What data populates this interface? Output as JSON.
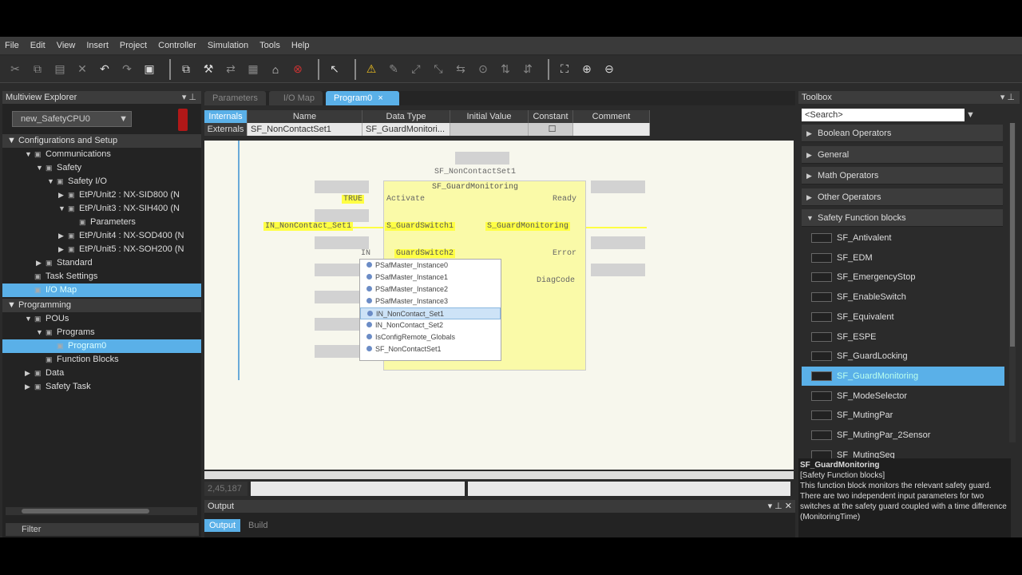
{
  "menu": [
    "File",
    "Edit",
    "View",
    "Insert",
    "Project",
    "Controller",
    "Simulation",
    "Tools",
    "Help"
  ],
  "explorer": {
    "title": "Multiview Explorer",
    "device": "new_SafetyCPU0",
    "config_section": "Configurations and Setup",
    "tree": [
      {
        "label": "Communications",
        "indent": 2,
        "twisty": "▼"
      },
      {
        "label": "Safety",
        "indent": 3,
        "twisty": "▼"
      },
      {
        "label": "Safety I/O",
        "indent": 4,
        "twisty": "▼"
      },
      {
        "label": "EtP/Unit2 : NX-SID800 (N",
        "indent": 5,
        "twisty": "▶"
      },
      {
        "label": "EtP/Unit3 : NX-SIH400 (N",
        "indent": 5,
        "twisty": "▼"
      },
      {
        "label": "Parameters",
        "indent": 6,
        "twisty": ""
      },
      {
        "label": "EtP/Unit4 : NX-SOD400 (N",
        "indent": 5,
        "twisty": "▶"
      },
      {
        "label": "EtP/Unit5 : NX-SOH200 (N",
        "indent": 5,
        "twisty": "▶"
      },
      {
        "label": "Standard",
        "indent": 3,
        "twisty": "▶"
      },
      {
        "label": "Task Settings",
        "indent": 2,
        "twisty": ""
      },
      {
        "label": "I/O Map",
        "indent": 2,
        "twisty": "",
        "selected": true
      }
    ],
    "programming_section": "Programming",
    "tree2": [
      {
        "label": "POUs",
        "indent": 2,
        "twisty": "▼"
      },
      {
        "label": "Programs",
        "indent": 3,
        "twisty": "▼"
      },
      {
        "label": "Program0",
        "indent": 4,
        "twisty": "",
        "selected": true
      },
      {
        "label": "Function Blocks",
        "indent": 3,
        "twisty": ""
      },
      {
        "label": "Data",
        "indent": 2,
        "twisty": "▶"
      },
      {
        "label": "Safety Task",
        "indent": 2,
        "twisty": "▶"
      }
    ],
    "filter": "Filter"
  },
  "tabs": [
    "Parameters",
    "I/O Map",
    "Program0"
  ],
  "vartable": {
    "side_tabs": [
      "Internals",
      "Externals"
    ],
    "headers": [
      "Name",
      "Data Type",
      "Initial Value",
      "Constant",
      "Comment"
    ],
    "row": {
      "name": "SF_NonContactSet1",
      "type": "SF_GuardMonitori..."
    }
  },
  "diagram": {
    "instance": "SF_NonContactSet1",
    "fb_name": "SF_GuardMonitoring",
    "in_true": "TRUE",
    "pin_activate": "Activate",
    "pin_ready": "Ready",
    "in_var": "IN_NonContact_Set1",
    "pin_s1": "S_GuardSwitch1",
    "pin_mon": "S_GuardMonitoring",
    "typing": "IN",
    "pin_s2": "GuardSwitch2",
    "pin_error": "Error",
    "pin_diag": "DiagCode"
  },
  "popup": [
    "PSafMaster_Instance0",
    "PSafMaster_Instance1",
    "PSafMaster_Instance2",
    "PSafMaster_Instance3",
    "IN_NonContact_Set1",
    "IN_NonContact_Set2",
    "IsConfigRemote_Globals",
    "SF_NonContactSet1"
  ],
  "status": {
    "coords": "2,45,187"
  },
  "output": {
    "title": "Output",
    "tabs": [
      "Output",
      "Build"
    ]
  },
  "toolbox": {
    "title": "Toolbox",
    "search": "<Search>",
    "categories": [
      "Boolean Operators",
      "General",
      "Math Operators",
      "Other Operators",
      "Safety Function blocks"
    ],
    "items": [
      "SF_Antivalent",
      "SF_EDM",
      "SF_EmergencyStop",
      "SF_EnableSwitch",
      "SF_Equivalent",
      "SF_ESPE",
      "SF_GuardLocking",
      "SF_GuardMonitoring",
      "SF_ModeSelector",
      "SF_MutingPar",
      "SF_MutingPar_2Sensor",
      "SF_MutingSeq"
    ],
    "desc_title": "SF_GuardMonitoring",
    "desc_cat": "[Safety Function blocks]",
    "desc_text": "This function block monitors the relevant safety guard. There are two independent input parameters for two switches at the safety guard coupled with a time difference (MonitoringTime)"
  }
}
